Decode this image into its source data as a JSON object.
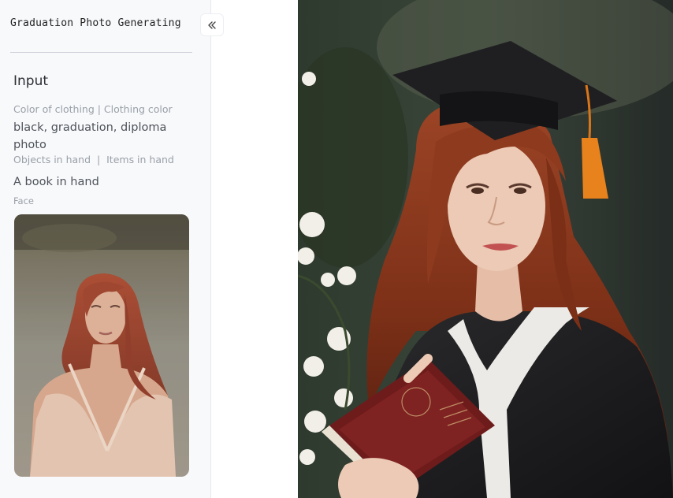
{
  "app": {
    "title": "Graduation Photo Generating"
  },
  "sidebar": {
    "collapse_icon": "double-chevron-left-icon",
    "section_title": "Input",
    "fields": {
      "clothing_label": "Color of clothing | Clothing color",
      "clothing_value": "black, graduation, diploma photo",
      "objects_label": "Objects in hand  |  Items in hand",
      "objects_value": "A book in hand",
      "face_label": "Face"
    },
    "face_image": "portrait-photo-red-haired-woman"
  },
  "main": {
    "result_image": "graduation-portrait-cap-gown-book"
  },
  "colors": {
    "sidebar_bg": "#f8f9fb",
    "label_gray": "#9aa0a8",
    "value_gray": "#4e525a",
    "tassel_orange": "#e8821c",
    "book_maroon": "#6e1b1b"
  }
}
